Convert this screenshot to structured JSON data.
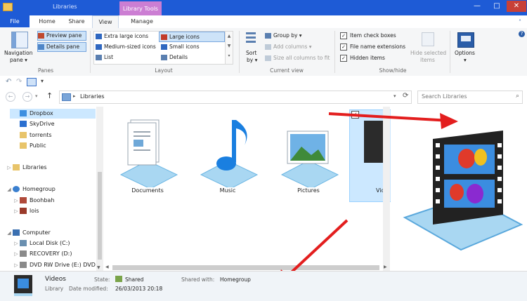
{
  "titlebar": {
    "title": "Libraries",
    "context_tab": "Library Tools",
    "min_label": "—",
    "max_label": "□",
    "close_label": "✕"
  },
  "tabs": [
    "File",
    "Home",
    "Share",
    "View",
    "Manage"
  ],
  "ribbon": {
    "panes": {
      "navigation_pane": "Navigation",
      "navigation_pane_2": "pane ▾",
      "preview_pane": "Preview pane",
      "details_pane": "Details pane",
      "label": "Panes"
    },
    "layout": {
      "options": [
        "Extra large icons",
        "Large icons",
        "Medium-sized icons",
        "Small icons",
        "List",
        "Details"
      ],
      "label": "Layout"
    },
    "current_view": {
      "sort_by": "Sort",
      "sort_by_2": "by ▾",
      "group_by": "Group by ▾",
      "add_columns": "Add columns ▾",
      "size_all_columns": "Size all columns to fit",
      "label": "Current view"
    },
    "show_hide": {
      "item_check_boxes": "Item check boxes",
      "file_name_extensions": "File name extensions",
      "hidden_items": "Hidden items",
      "hide_selected_items": "Hide selected",
      "hide_selected_items_2": "items",
      "label": "Show/hide"
    },
    "options": {
      "label": "Options",
      "arrow": "▾"
    }
  },
  "address": {
    "breadcrumb": "Libraries",
    "search_placeholder": "Search Libraries"
  },
  "nav": {
    "items": [
      {
        "label": "Dropbox",
        "color": "#3d8fe0"
      },
      {
        "label": "SkyDrive",
        "color": "#2a6fd0"
      },
      {
        "label": "torrents",
        "color": "#e8c46a"
      },
      {
        "label": "Public",
        "color": "#e8c46a"
      },
      {
        "label": "Libraries",
        "color": "#e8c46a"
      },
      {
        "label": "Homegroup",
        "color": "#3a7fcf"
      },
      {
        "label": "Boohbah",
        "color": "#b04a3a"
      },
      {
        "label": "lois",
        "color": "#9a3a2a"
      },
      {
        "label": "Computer",
        "color": "#3a6fb0"
      },
      {
        "label": "Local Disk (C:)",
        "color": "#6a8fb0"
      },
      {
        "label": "RECOVERY (D:)",
        "color": "#8a8a8a"
      },
      {
        "label": "DVD RW Drive (E:) DVD",
        "color": "#8a8a8a"
      }
    ]
  },
  "libraries": [
    {
      "label": "Documents"
    },
    {
      "label": "Music"
    },
    {
      "label": "Pictures"
    },
    {
      "label": "Vide"
    }
  ],
  "status": {
    "name": "Videos",
    "type": "Library",
    "state_label": "State:",
    "state_value": "Shared",
    "date_label": "Date modified:",
    "date_value": "26/03/2013 20:18",
    "shared_with_label": "Shared with:",
    "shared_with_value": "Homegroup"
  },
  "colors": {
    "accent": "#1e5bd6",
    "context_tab": "#cc7ed3",
    "arrow": "#e31e1e",
    "selection": "#cce8ff"
  }
}
